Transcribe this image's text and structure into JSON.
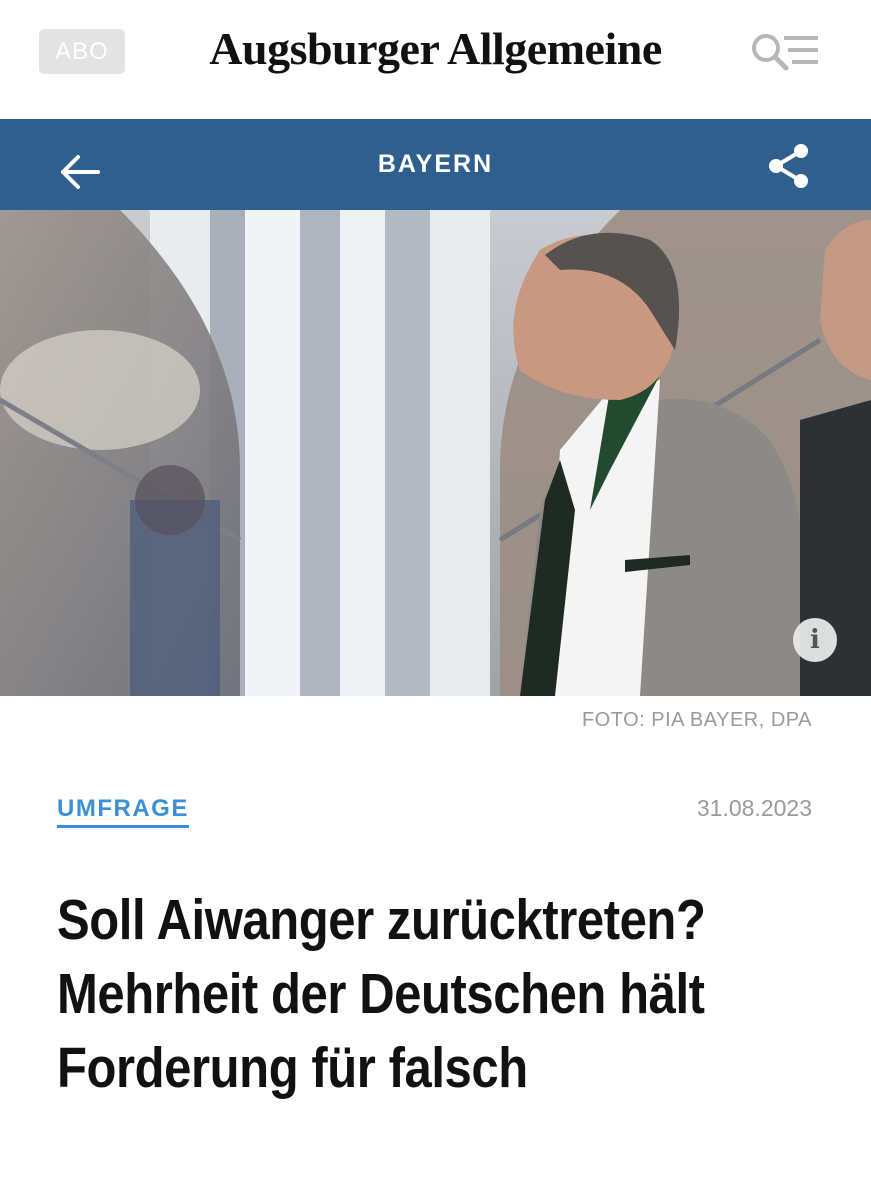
{
  "header": {
    "abo_label": "ABO",
    "logo_text": "Augsburger Allgemeine",
    "icons": [
      "search-icon",
      "menu-icon"
    ]
  },
  "section_bar": {
    "title": "BAYERN",
    "back_icon": "arrow-left-icon",
    "share_icon": "share-icon",
    "color": "#2e5f8f"
  },
  "hero": {
    "info_label": "i",
    "credit": "FOTO: PIA BAYER, DPA"
  },
  "article": {
    "kicker": "UMFRAGE",
    "date": "31.08.2023",
    "headline": "Soll Aiwanger zurücktreten? Mehrheit der Deutschen hält Forderung für falsch",
    "kicker_color": "#3d8fd6"
  }
}
